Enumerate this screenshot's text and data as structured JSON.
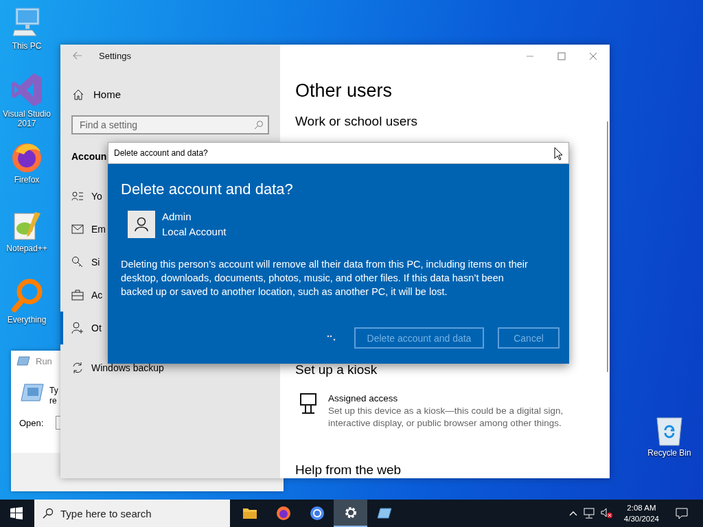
{
  "desktop_icons": [
    {
      "label": "This PC"
    },
    {
      "label": "Visual Studio 2017"
    },
    {
      "label": "Firefox"
    },
    {
      "label": "Notepad++"
    },
    {
      "label": "Everything"
    },
    {
      "label": "Recycle Bin"
    }
  ],
  "run_window": {
    "title": "Run",
    "prompt_lines": [
      "Ty",
      "re"
    ],
    "open_label": "Open:"
  },
  "settings_window": {
    "title": "Settings",
    "home": "Home",
    "search": {
      "placeholder": "Find a setting"
    },
    "section": "Accoun",
    "nav_items": [
      {
        "label": "Yo",
        "selected": false
      },
      {
        "label": "Em",
        "selected": false
      },
      {
        "label": "Si",
        "selected": false
      },
      {
        "label": "Ac",
        "selected": false
      },
      {
        "label": "Ot",
        "selected": true
      },
      {
        "label": "Windows backup",
        "selected": false
      }
    ],
    "page_title": "Other users",
    "sections": [
      "Work or school users",
      "Set up a kiosk"
    ],
    "kiosk_item": {
      "title": "Assigned access",
      "description": "Set up this device as a kiosk—this could be a digital sign, interactive display, or public browser among other things."
    },
    "help_heading": "Help from the web"
  },
  "dialog": {
    "title": "Delete account and data?",
    "heading": "Delete account and data?",
    "account": {
      "name": "Admin",
      "type": "Local Account"
    },
    "message": "Deleting this person’s account will remove all their data from this PC, including items on their desktop, downloads, documents, photos, music, and other files. If this data hasn’t been backed up or saved to another location, such as another PC, it will be lost.",
    "buttons": [
      {
        "label": "Delete account and data",
        "disabled": true
      },
      {
        "label": "Cancel",
        "disabled": true
      }
    ]
  },
  "taskbar": {
    "search": {
      "placeholder": "Type here to search"
    },
    "apps": [
      {
        "active": false
      },
      {
        "active": false
      },
      {
        "active": false
      },
      {
        "active": true
      },
      {
        "active": false
      }
    ],
    "time": "2:08 AM",
    "date": "4/30/2024"
  }
}
